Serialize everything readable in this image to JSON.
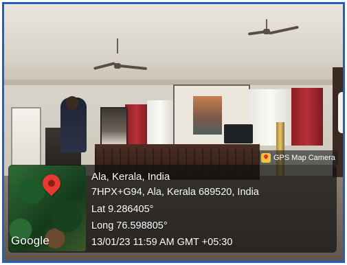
{
  "badge": {
    "label": "GPS Map Camera",
    "icon": "gps-map-camera-icon"
  },
  "map": {
    "provider_label": "Google",
    "pin_icon": "map-pin-icon"
  },
  "location": {
    "place": "Ala, Kerala, India",
    "address": "7HPX+G94, Ala, Kerala 689520, India",
    "latitude": "Lat 9.286405°",
    "longitude": "Long 76.598805°",
    "datetime": "13/01/23 11:59 AM GMT +05:30"
  },
  "colors": {
    "border": "#1e5fc2",
    "pin": "#e53b30",
    "badge_icon": "#f5c23d"
  }
}
